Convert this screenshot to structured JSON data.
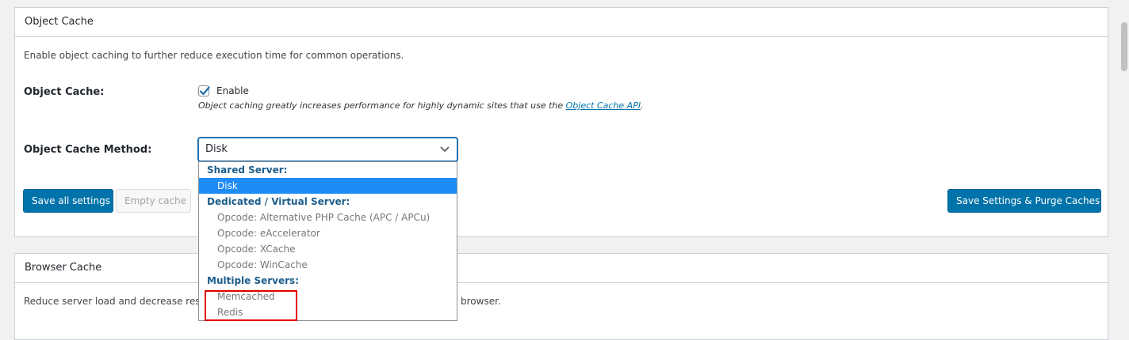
{
  "object_cache": {
    "title": "Object Cache",
    "description": "Enable object caching to further reduce execution time for common operations.",
    "cache_label": "Object Cache:",
    "enable_label": "Enable",
    "help_prefix": "Object caching greatly increases performance for highly dynamic sites that use the ",
    "help_link": "Object Cache API",
    "help_suffix": ".",
    "method_label": "Object Cache Method:",
    "method_value": "Disk",
    "save_all": "Save all settings",
    "empty_cache": "Empty cache",
    "save_purge": "Save Settings & Purge Caches"
  },
  "dropdown": {
    "groups": [
      {
        "label": "Shared Server:",
        "options": [
          "Disk"
        ]
      },
      {
        "label": "Dedicated / Virtual Server:",
        "options": [
          "Opcode: Alternative PHP Cache (APC / APCu)",
          "Opcode: eAccelerator",
          "Opcode: XCache",
          "Opcode: WinCache"
        ]
      },
      {
        "label": "Multiple Servers:",
        "options": [
          "Memcached",
          "Redis"
        ]
      }
    ],
    "selected": "Disk"
  },
  "browser_cache": {
    "title": "Browser Cache",
    "description_start": "Reduce server load and decrease respo",
    "description_end": "browser."
  },
  "colors": {
    "primary": "#0073aa",
    "selected_option": "#1e8cf7",
    "group_label": "#1d5d8c",
    "highlight": "#e00000"
  }
}
